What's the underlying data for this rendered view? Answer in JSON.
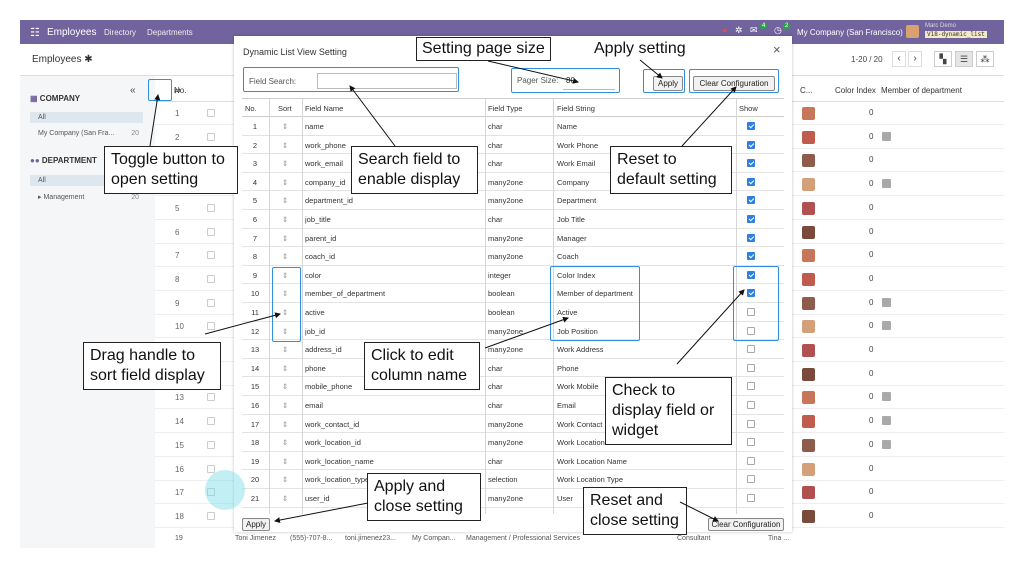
{
  "navbar": {
    "app_name": "Employees",
    "menu": [
      "Directory",
      "Departments"
    ],
    "company": "My Company (San Francisco)",
    "user": "Marc Demo",
    "db": "V18-dynamic_list",
    "badges": [
      "4",
      "2"
    ]
  },
  "control": {
    "breadcrumb": "Employees",
    "pager": "1-20 / 20"
  },
  "sidebar": {
    "company_header": "COMPANY",
    "company_items": [
      {
        "label": "All",
        "count": ""
      },
      {
        "label": "My Company (San Fra...",
        "count": "20"
      }
    ],
    "department_header": "DEPARTMENT",
    "department_items": [
      {
        "label": "All",
        "count": ""
      },
      {
        "label": "Management",
        "count": "20"
      }
    ],
    "collapse": "«"
  },
  "list": {
    "headers": [
      "No.",
      "C...",
      "Color Index",
      "Member of department"
    ],
    "rows": [
      {
        "n": "1",
        "ci": "0",
        "m": false
      },
      {
        "n": "2",
        "ci": "0",
        "m": true
      },
      {
        "n": "3",
        "ci": "0",
        "m": false
      },
      {
        "n": "4",
        "ci": "0",
        "m": true
      },
      {
        "n": "5",
        "ci": "0",
        "m": false
      },
      {
        "n": "6",
        "ci": "0",
        "m": false
      },
      {
        "n": "7",
        "ci": "0",
        "m": false
      },
      {
        "n": "8",
        "ci": "0",
        "m": false
      },
      {
        "n": "9",
        "ci": "0",
        "m": true
      },
      {
        "n": "10",
        "ci": "0",
        "m": true
      },
      {
        "n": "11",
        "ci": "0",
        "m": false
      },
      {
        "n": "12",
        "ci": "0",
        "m": false
      },
      {
        "n": "13",
        "ci": "0",
        "m": true
      },
      {
        "n": "14",
        "ci": "0",
        "m": true
      },
      {
        "n": "15",
        "ci": "0",
        "m": true
      },
      {
        "n": "16",
        "ci": "0",
        "m": false
      },
      {
        "n": "17",
        "ci": "0",
        "m": false
      },
      {
        "n": "18",
        "ci": "0",
        "m": false
      }
    ],
    "footer": {
      "n": "19",
      "name": "Toni Jimenez",
      "phone": "(555)-707-8...",
      "email": "toni.jimenez23...",
      "company": "My Compan...",
      "dept": "Management / Professional Services",
      "job": "Consultant",
      "coach": "Tina ..."
    }
  },
  "dialog": {
    "title": "Dynamic List View Setting",
    "close": "×",
    "field_search_label": "Field Search:",
    "field_search_value": "",
    "pager_label": "Pager Size:",
    "pager_value": "80",
    "apply": "Apply",
    "clear": "Clear Configuration",
    "headers": [
      "No.",
      "Sort",
      "Field Name",
      "Field Type",
      "Field String",
      "Show"
    ],
    "rows": [
      {
        "no": "1",
        "name": "name",
        "type": "char",
        "str": "Name",
        "show": true
      },
      {
        "no": "2",
        "name": "work_phone",
        "type": "char",
        "str": "Work Phone",
        "show": true
      },
      {
        "no": "3",
        "name": "work_email",
        "type": "char",
        "str": "Work Email",
        "show": true
      },
      {
        "no": "4",
        "name": "company_id",
        "type": "many2one",
        "str": "Company",
        "show": true
      },
      {
        "no": "5",
        "name": "department_id",
        "type": "many2one",
        "str": "Department",
        "show": true
      },
      {
        "no": "6",
        "name": "job_title",
        "type": "char",
        "str": "Job Title",
        "show": true
      },
      {
        "no": "7",
        "name": "parent_id",
        "type": "many2one",
        "str": "Manager",
        "show": true
      },
      {
        "no": "8",
        "name": "coach_id",
        "type": "many2one",
        "str": "Coach",
        "show": true
      },
      {
        "no": "9",
        "name": "color",
        "type": "integer",
        "str": "Color Index",
        "show": true
      },
      {
        "no": "10",
        "name": "member_of_department",
        "type": "boolean",
        "str": "Member of department",
        "show": true
      },
      {
        "no": "11",
        "name": "active",
        "type": "boolean",
        "str": "Active",
        "show": false
      },
      {
        "no": "12",
        "name": "job_id",
        "type": "many2one",
        "str": "Job Position",
        "show": false
      },
      {
        "no": "13",
        "name": "address_id",
        "type": "many2one",
        "str": "Work Address",
        "show": false
      },
      {
        "no": "14",
        "name": "phone",
        "type": "char",
        "str": "Phone",
        "show": false
      },
      {
        "no": "15",
        "name": "mobile_phone",
        "type": "char",
        "str": "Work Mobile",
        "show": false
      },
      {
        "no": "16",
        "name": "email",
        "type": "char",
        "str": "Email",
        "show": false
      },
      {
        "no": "17",
        "name": "work_contact_id",
        "type": "many2one",
        "str": "Work Contact",
        "show": false
      },
      {
        "no": "18",
        "name": "work_location_id",
        "type": "many2one",
        "str": "Work Location",
        "show": false
      },
      {
        "no": "19",
        "name": "work_location_name",
        "type": "char",
        "str": "Work Location Name",
        "show": false
      },
      {
        "no": "20",
        "name": "work_location_type",
        "type": "selection",
        "str": "Work Location Type",
        "show": false
      },
      {
        "no": "21",
        "name": "user_id",
        "type": "many2one",
        "str": "User",
        "show": false
      }
    ]
  },
  "annotations": {
    "setting_page_size": "Setting page size",
    "apply_setting": "Apply setting",
    "search_field": "Search field to enable display",
    "toggle": "Toggle button to  open  setting",
    "reset_default": "Reset to default setting",
    "drag": "Drag handle to sort field display",
    "click_edit": "Click to edit column name",
    "check_display": "Check to display field or widget",
    "apply_close": "Apply and close setting",
    "reset_close": "Reset and close setting"
  },
  "colors": {
    "navbar": "#71639e",
    "highlight": "#2f8fe0",
    "checked": "#2f7fe1"
  }
}
